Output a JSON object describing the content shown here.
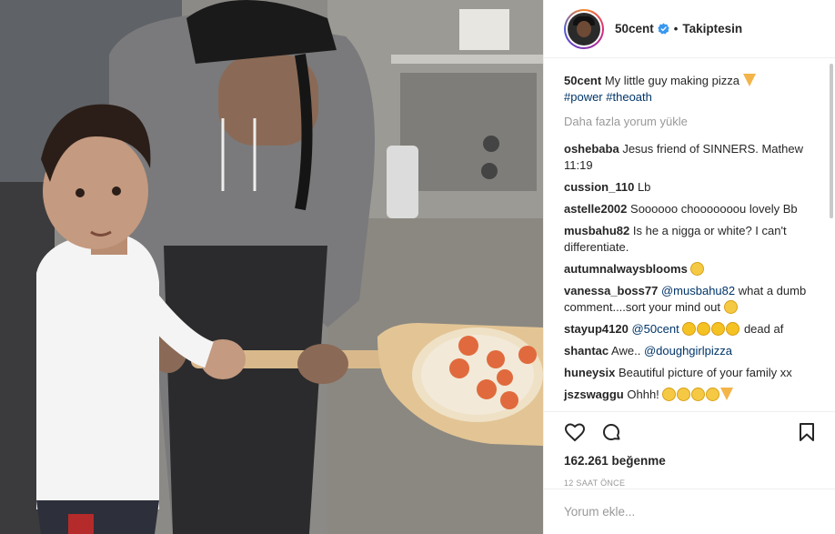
{
  "header": {
    "username": "50cent",
    "follow_label": "Takiptesin",
    "separator": "•"
  },
  "caption": {
    "username": "50cent",
    "text": "My little guy making pizza",
    "hashtags": [
      "#power",
      "#theoath"
    ]
  },
  "load_more_label": "Daha fazla yorum yükle",
  "comments": [
    {
      "user": "oshebaba",
      "text": "Jesus friend of SINNERS. Mathew 11:19"
    },
    {
      "user": "cussion_110",
      "text": "Lb"
    },
    {
      "user": "astelle2002",
      "text": "Soooooo chooooooou lovely Bb"
    },
    {
      "user": "musbahu82",
      "text": "Is he a nigga or white? I can't differentiate."
    },
    {
      "user": "autumnalwaysblooms",
      "text": ""
    },
    {
      "user": "vanessa_boss77",
      "mention": "@musbahu82",
      "text": "what a dumb comment....sort your mind out"
    },
    {
      "user": "stayup4120",
      "mention": "@50cent",
      "text": "dead af"
    },
    {
      "user": "shantac",
      "text": "Awe..",
      "mention": "@doughgirlpizza"
    },
    {
      "user": "huneysix",
      "text": "Beautiful picture of your family xx"
    },
    {
      "user": "jszswaggu",
      "text": "Ohhh!"
    }
  ],
  "likes": "162.261 beğenme",
  "time": "12 SAAT ÖNCE",
  "comment_input": {
    "placeholder": "Yorum ekle..."
  },
  "icons": {
    "like": "heart-icon",
    "comment": "comment-bubble-icon",
    "save": "bookmark-icon",
    "verified": "verified-badge-icon"
  },
  "colors": {
    "link": "#003569",
    "verified": "#3897f0",
    "muted": "#999999",
    "text": "#262626"
  }
}
